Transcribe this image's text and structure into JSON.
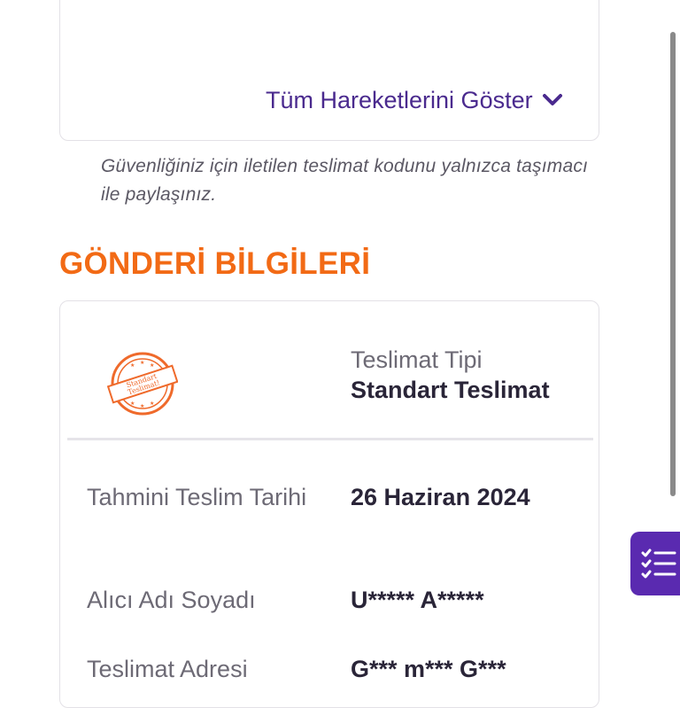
{
  "tracking": {
    "show_all_label": "Tüm Hareketlerini Göster",
    "security_note": "Güvenliğiniz için iletilen teslimat kodunu yalnızca taşımacı ile paylaşınız."
  },
  "shipment": {
    "section_title": "GÖNDERİ BİLGİLERİ",
    "stamp": {
      "line1": "Standart",
      "line2": "Teslimat!"
    },
    "delivery_type_label": "Teslimat Tipi",
    "delivery_type_value": "Standart Teslimat",
    "rows": [
      {
        "label": "Tahmini Teslim Tarihi",
        "value": "26 Haziran 2024"
      },
      {
        "label": "Alıcı Adı Soyadı",
        "value": "U***** A*****"
      },
      {
        "label": "Teslimat Adresi",
        "value": "G*** m*** G***"
      }
    ]
  },
  "colors": {
    "accent_purple": "#4a2a8e",
    "fab_purple": "#5a2ab0",
    "section_orange": "#f26a15",
    "stamp_orange": "#ef6a2b"
  },
  "icons": {
    "show_all": "chevron-down-icon",
    "fab": "checklist-icon",
    "stamp": "standard-delivery-stamp-icon"
  }
}
